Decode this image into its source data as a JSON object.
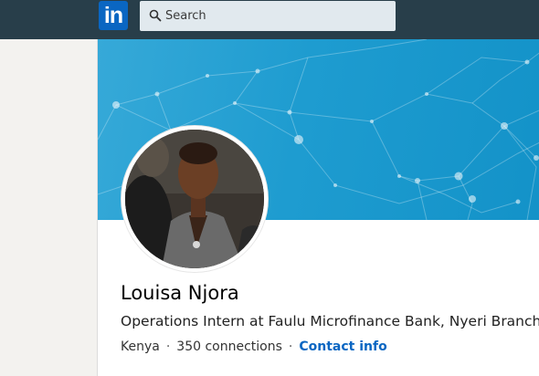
{
  "nav": {
    "logo_text": "in",
    "search_placeholder": "Search"
  },
  "profile": {
    "name": "Louisa Njora",
    "headline": "Operations Intern at Faulu Microfinance Bank, Nyeri Branch",
    "location": "Kenya",
    "connections": "350 connections",
    "contact_info": "Contact info"
  },
  "colors": {
    "nav_bg": "#283e4a",
    "brand": "#0a66c2",
    "banner": "#1e9cd0"
  }
}
